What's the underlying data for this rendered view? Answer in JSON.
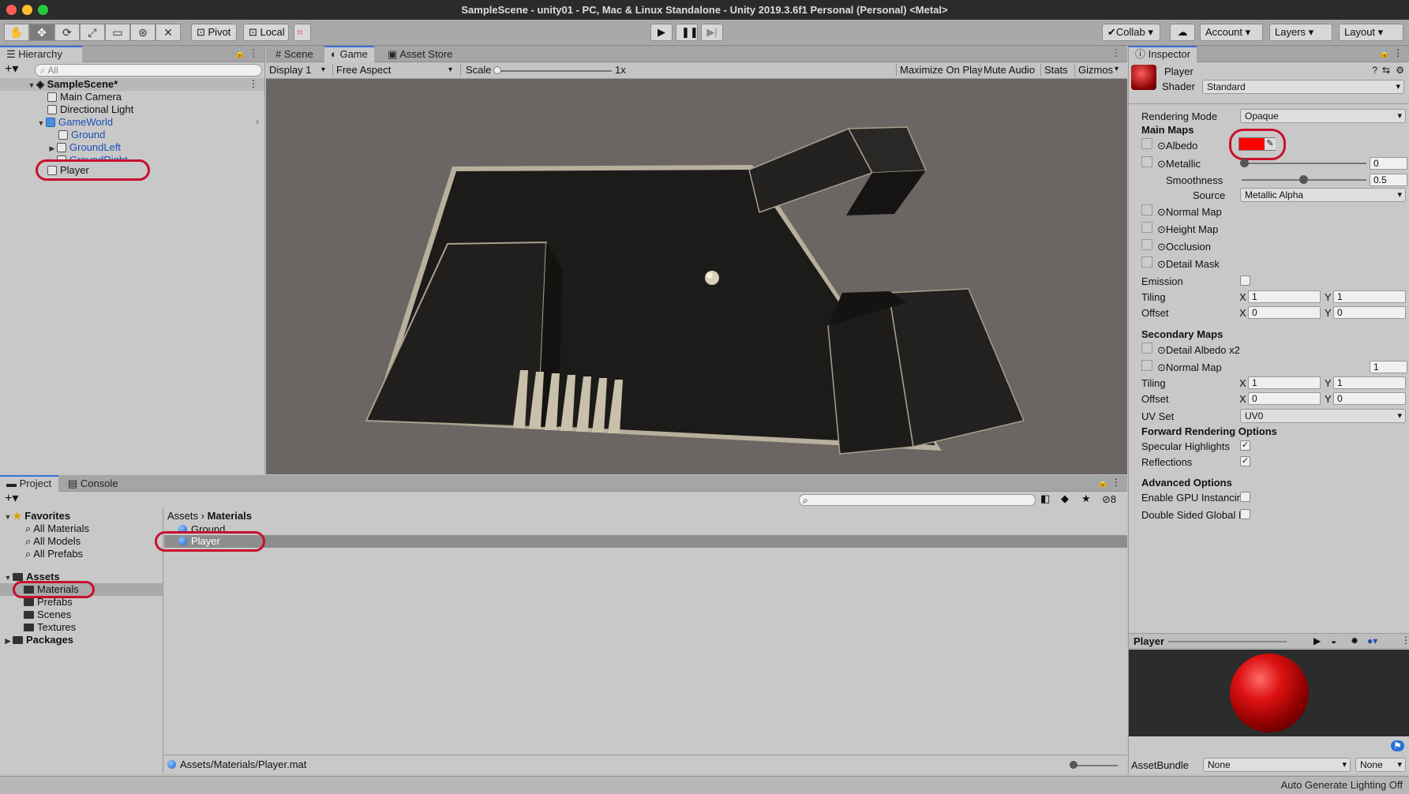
{
  "window": {
    "title": "SampleScene - unity01 - PC, Mac & Linux Standalone - Unity 2019.3.6f1 Personal (Personal) <Metal>"
  },
  "toolbar": {
    "pivot": "Pivot",
    "local": "Local",
    "collab": "Collab",
    "account": "Account",
    "layers": "Layers",
    "layout": "Layout"
  },
  "hierarchy": {
    "tab": "Hierarchy",
    "search_placeholder": "All",
    "scene": "SampleScene*",
    "items": [
      {
        "label": "Main Camera"
      },
      {
        "label": "Directional Light"
      },
      {
        "label": "GameWorld"
      },
      {
        "label": "Ground"
      },
      {
        "label": "GroundLeft"
      },
      {
        "label": "GroundRight"
      },
      {
        "label": "Player"
      }
    ]
  },
  "game": {
    "tabs": [
      "Scene",
      "Game",
      "Asset Store"
    ],
    "display": "Display 1",
    "aspect": "Free Aspect",
    "scale_label": "Scale",
    "scale_value": "1x",
    "maximize": "Maximize On Play",
    "mute": "Mute Audio",
    "stats": "Stats",
    "gizmos": "Gizmos"
  },
  "project": {
    "tabs": [
      "Project",
      "Console"
    ],
    "hidden_count": "8",
    "favorites": "Favorites",
    "fav_items": [
      "All Materials",
      "All Models",
      "All Prefabs"
    ],
    "assets": "Assets",
    "asset_folders": [
      "Materials",
      "Prefabs",
      "Scenes",
      "Textures"
    ],
    "packages": "Packages",
    "breadcrumb": [
      "Assets",
      "Materials"
    ],
    "files": [
      "Ground",
      "Player"
    ],
    "status_path": "Assets/Materials/Player.mat"
  },
  "inspector": {
    "tab": "Inspector",
    "object_name": "Player",
    "shader_label": "Shader",
    "shader_value": "Standard",
    "rendering_mode_label": "Rendering Mode",
    "rendering_mode_value": "Opaque",
    "main_maps": "Main Maps",
    "albedo": "Albedo",
    "albedo_color": "#ff0000",
    "metallic": "Metallic",
    "metallic_value": "0",
    "smoothness": "Smoothness",
    "smoothness_value": "0.5",
    "source": "Source",
    "source_value": "Metallic Alpha",
    "normal_map": "Normal Map",
    "height_map": "Height Map",
    "occlusion": "Occlusion",
    "detail_mask": "Detail Mask",
    "emission": "Emission",
    "tiling": "Tiling",
    "offset": "Offset",
    "x": "X",
    "y": "Y",
    "tiling_x": "1",
    "tiling_y": "1",
    "offset_x": "0",
    "offset_y": "0",
    "secondary_maps": "Secondary Maps",
    "detail_albedo": "Detail Albedo x2",
    "normal_map2": "Normal Map",
    "normal_map2_value": "1",
    "tiling2_x": "1",
    "tiling2_y": "1",
    "offset2_x": "0",
    "offset2_y": "0",
    "uv_set": "UV Set",
    "uv_set_value": "UV0",
    "forward_options": "Forward Rendering Options",
    "specular": "Specular Highlights",
    "reflections": "Reflections",
    "advanced": "Advanced Options",
    "gpu_instancing": "Enable GPU Instancin",
    "double_sided": "Double Sided Global I",
    "preview_title": "Player",
    "assetbundle_label": "AssetBundle",
    "assetbundle_value": "None",
    "assetbundle_variant": "None"
  },
  "statusbar": {
    "text": "Auto Generate Lighting Off"
  },
  "colors": {
    "accent": "#3a72d8",
    "highlight": "#c8102e"
  }
}
